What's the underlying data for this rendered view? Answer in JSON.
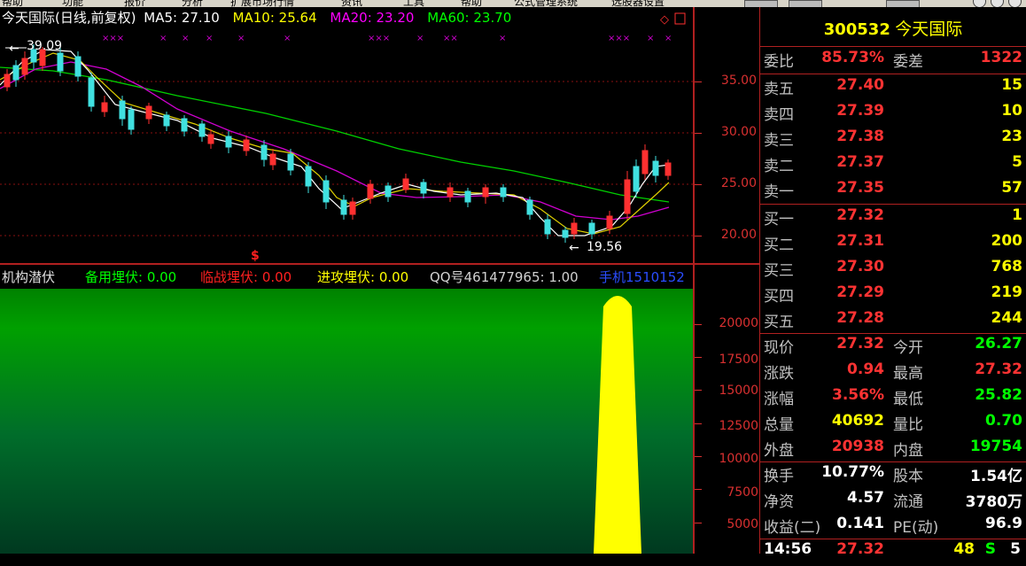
{
  "menu": {
    "items": [
      "帮助",
      "功能",
      "报价",
      "分析",
      "扩展市场行情",
      "资讯",
      "工具",
      "帮助",
      "公式管理系统",
      "选股器设置"
    ],
    "buttons": [
      "",
      "",
      ""
    ]
  },
  "chart": {
    "title": "今天国际(日线,前复权)",
    "ma": [
      {
        "label": "MA5: 27.10",
        "color": "#ffffff"
      },
      {
        "label": "MA10: 25.64",
        "color": "#ffff00"
      },
      {
        "label": "MA20: 23.20",
        "color": "#ff00ff"
      },
      {
        "label": "MA60: 23.70",
        "color": "#00ff00"
      }
    ],
    "high_label": "39.09",
    "low_label": "19.56",
    "y_ticks": [
      "35.00",
      "30.00",
      "25.00",
      "20.00"
    ],
    "marker": "$"
  },
  "indicator": {
    "name": "机构潜伏",
    "items": [
      {
        "label": "备用埋伏: 0.00",
        "color": "#00ff00"
      },
      {
        "label": "临战埋伏: 0.00",
        "color": "#ff2020"
      },
      {
        "label": "进攻埋伏: 0.00",
        "color": "#ffff00"
      },
      {
        "label": "QQ号461477965: 1.00",
        "color": "#d0d0d0"
      },
      {
        "label": "手机1510152",
        "color": "#2a4dff"
      }
    ],
    "y_ticks": [
      "20000",
      "17500",
      "15000",
      "12500",
      "10000",
      "7500",
      "5000"
    ]
  },
  "quote": {
    "code": "300532",
    "name": "今天国际",
    "weibi_label": "委比",
    "weibi_value": "85.73%",
    "weicha_label": "委差",
    "weicha_value": "1322",
    "sell": [
      {
        "label": "卖五",
        "price": "27.40",
        "vol": "15"
      },
      {
        "label": "卖四",
        "price": "27.39",
        "vol": "10"
      },
      {
        "label": "卖三",
        "price": "27.38",
        "vol": "23"
      },
      {
        "label": "卖二",
        "price": "27.37",
        "vol": "5"
      },
      {
        "label": "卖一",
        "price": "27.35",
        "vol": "57"
      }
    ],
    "buy": [
      {
        "label": "买一",
        "price": "27.32",
        "vol": "1"
      },
      {
        "label": "买二",
        "price": "27.31",
        "vol": "200"
      },
      {
        "label": "买三",
        "price": "27.30",
        "vol": "768"
      },
      {
        "label": "买四",
        "price": "27.29",
        "vol": "219"
      },
      {
        "label": "买五",
        "price": "27.28",
        "vol": "244"
      }
    ],
    "stats": [
      {
        "l1": "现价",
        "v1": "27.32",
        "c1": "#ff3333",
        "l2": "今开",
        "v2": "26.27",
        "c2": "#00ff00"
      },
      {
        "l1": "涨跌",
        "v1": "0.94",
        "c1": "#ff3333",
        "l2": "最高",
        "v2": "27.32",
        "c2": "#ff3333"
      },
      {
        "l1": "涨幅",
        "v1": "3.56%",
        "c1": "#ff3333",
        "l2": "最低",
        "v2": "25.82",
        "c2": "#00ff00"
      },
      {
        "l1": "总量",
        "v1": "40692",
        "c1": "#ffff00",
        "l2": "量比",
        "v2": "0.70",
        "c2": "#00ff00"
      },
      {
        "l1": "外盘",
        "v1": "20938",
        "c1": "#ff3333",
        "l2": "内盘",
        "v2": "19754",
        "c2": "#00ff00"
      }
    ],
    "stats2": [
      {
        "l1": "换手",
        "v1": "10.77%",
        "l2": "股本",
        "v2": "1.54亿"
      },
      {
        "l1": "净资",
        "v1": "4.57",
        "l2": "流通",
        "v2": "3780万"
      },
      {
        "l1": "收益(二)",
        "v1": "0.141",
        "l2": "PE(动)",
        "v2": "96.9"
      }
    ],
    "tick": {
      "time": "14:56",
      "price": "27.32",
      "vol": "48",
      "side": "S",
      "n": "5"
    }
  }
}
